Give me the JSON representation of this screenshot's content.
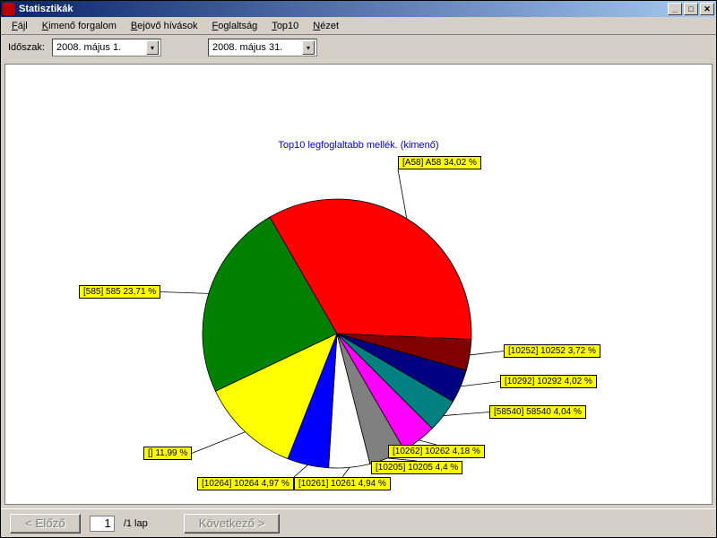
{
  "window": {
    "title": "Statisztikák"
  },
  "menu": {
    "items": [
      "Fájl",
      "Kimenő forgalom",
      "Bejövő hívások",
      "Foglaltság",
      "Top10",
      "Nézet"
    ]
  },
  "toolbar": {
    "period_label": "Időszak:",
    "date_from": "2008.    május       1.",
    "date_to": "2008.    május     31."
  },
  "footer": {
    "prev": "< Előző",
    "next": "Következő >",
    "page_value": "1",
    "page_suffix": "/1 lap"
  },
  "chart_data": {
    "type": "pie",
    "title": "Top10 legfoglaltabb mellék. (kimenő)",
    "series": [
      {
        "name": "[A58] A58",
        "value": 34.02,
        "color": "#ff0000",
        "label": "[A58] A58 34,02 %"
      },
      {
        "name": "[10252] 10252",
        "value": 3.72,
        "color": "#800000",
        "label": "[10252] 10252 3,72 %"
      },
      {
        "name": "[10292] 10292",
        "value": 4.02,
        "color": "#000080",
        "label": "[10292] 10292 4,02 %"
      },
      {
        "name": "[58540] 58540",
        "value": 4.04,
        "color": "#008080",
        "label": "[58540] 58540 4,04 %"
      },
      {
        "name": "[10262] 10262",
        "value": 4.18,
        "color": "#ff00ff",
        "label": "[10262] 10262 4,18 %"
      },
      {
        "name": "[10205] 10205",
        "value": 4.4,
        "color": "#808080",
        "label": "[10205] 10205 4,4 %"
      },
      {
        "name": "[10261] 10261",
        "value": 4.94,
        "color": "#ffffff",
        "label": "[10261] 10261 4,94 %"
      },
      {
        "name": "[10264] 10264",
        "value": 4.97,
        "color": "#0000ff",
        "label": "[10264] 10264 4,97 %"
      },
      {
        "name": "[]",
        "value": 11.99,
        "color": "#ffff00",
        "label": "[]  11,99 %"
      },
      {
        "name": "[585] 585",
        "value": 23.71,
        "color": "#008000",
        "label": "[585] 585 23,71 %"
      }
    ]
  }
}
